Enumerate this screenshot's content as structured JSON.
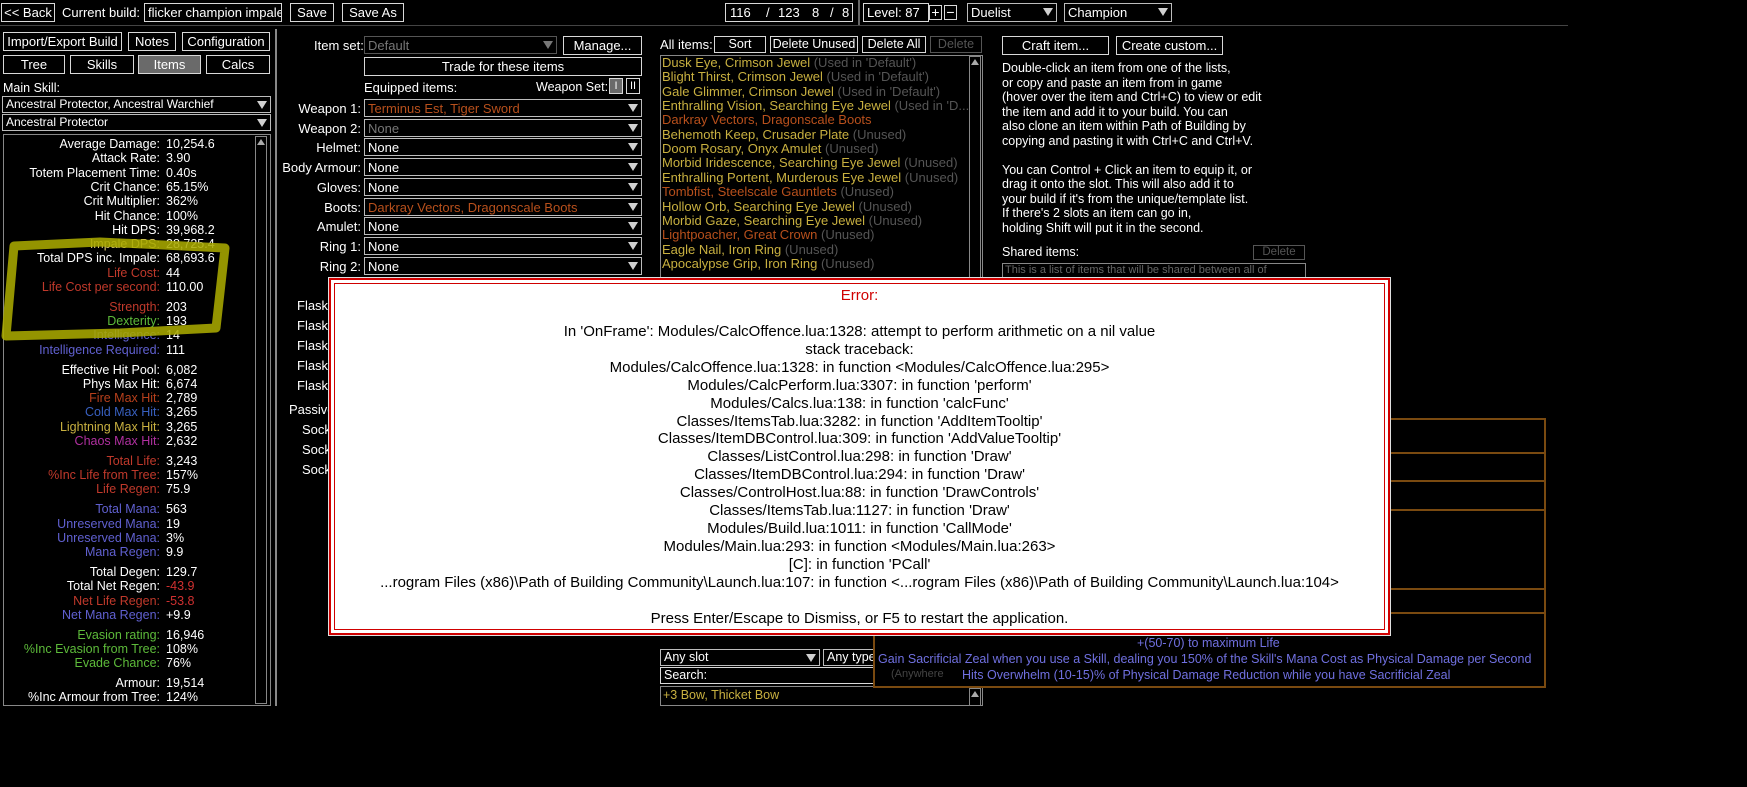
{
  "topbar": {
    "back": "<< Back",
    "current_build_label": "Current build:",
    "build_name": "flicker champion impale",
    "save": "Save",
    "save_as": "Save As",
    "points_used": "116",
    "points_total": "123",
    "asc_used": "8",
    "asc_total": "8",
    "level": "Level: 87",
    "class": "Duelist",
    "ascendancy": "Champion",
    "plus": "+",
    "minus": "−",
    "slash1": "/",
    "slash2": "/"
  },
  "left": {
    "import_export": "Import/Export Build",
    "notes": "Notes",
    "configuration": "Configuration",
    "tabs": [
      "Tree",
      "Skills",
      "Items",
      "Calcs"
    ],
    "main_skill_label": "Main Skill:",
    "main_skill": "Ancestral Protector, Ancestral Warchief",
    "sub_skill": "Ancestral Protector"
  },
  "stats": [
    {
      "label": "Average Damage:",
      "value": "10,254.6",
      "color": "#ffffff"
    },
    {
      "label": "Attack Rate:",
      "value": "3.90",
      "color": "#ffffff"
    },
    {
      "label": "Totem Placement Time:",
      "value": "0.40s",
      "color": "#ffffff"
    },
    {
      "label": "Crit Chance:",
      "value": "65.15%",
      "color": "#ffffff"
    },
    {
      "label": "Crit Multiplier:",
      "value": "362%",
      "color": "#ffffff"
    },
    {
      "label": "Hit Chance:",
      "value": "100%",
      "color": "#ffffff"
    },
    {
      "label": "Hit DPS:",
      "value": "39,968.2",
      "color": "#ffffff"
    },
    {
      "label": "Impale DPS:",
      "value": "28,725.4",
      "color": "#e0d070"
    },
    {
      "label": "Total DPS inc. Impale:",
      "value": "68,693.6",
      "color": "#ffffff"
    },
    {
      "label": "Life Cost:",
      "value": "44",
      "color": "#c0392b"
    },
    {
      "label": "Life Cost per second:",
      "value": "110.00",
      "color": "#c0392b"
    },
    {
      "gap": true
    },
    {
      "label": "Strength:",
      "value": "203",
      "color": "#c0392b"
    },
    {
      "label": "Dexterity:",
      "value": "193",
      "color": "#5dbb3a"
    },
    {
      "label": "Intelligence:",
      "value": "14",
      "color": "#6060d0"
    },
    {
      "label": "Intelligence Required:",
      "value": "111",
      "color": "#6060d0"
    },
    {
      "gap": true
    },
    {
      "label": "Effective Hit Pool:",
      "value": "6,082",
      "color": "#ffffff"
    },
    {
      "label": "Phys Max Hit:",
      "value": "6,674",
      "color": "#ffffff"
    },
    {
      "label": "Fire Max Hit:",
      "value": "2,789",
      "color": "#b8401c"
    },
    {
      "label": "Cold Max Hit:",
      "value": "3,265",
      "color": "#3860c0"
    },
    {
      "label": "Lightning Max Hit:",
      "value": "3,265",
      "color": "#c8b040"
    },
    {
      "label": "Chaos Max Hit:",
      "value": "2,632",
      "color": "#b030a0"
    },
    {
      "gap": true
    },
    {
      "label": "Total Life:",
      "value": "3,243",
      "color": "#c0392b"
    },
    {
      "label": "%Inc Life from Tree:",
      "value": "157%",
      "color": "#c0392b"
    },
    {
      "label": "Life Regen:",
      "value": "75.9",
      "color": "#c0392b"
    },
    {
      "gap": true
    },
    {
      "label": "Total Mana:",
      "value": "563",
      "color": "#6060d0"
    },
    {
      "label": "Unreserved Mana:",
      "value": "19",
      "color": "#6060d0"
    },
    {
      "label": "Unreserved Mana:",
      "value": "3%",
      "color": "#6060d0"
    },
    {
      "label": "Mana Regen:",
      "value": "9.9",
      "color": "#6060d0"
    },
    {
      "gap": true
    },
    {
      "label": "Total Degen:",
      "value": "129.7",
      "color": "#ffffff"
    },
    {
      "label": "Total Net Regen:",
      "value": "-43.9",
      "color": "#ffffff",
      "vcolor": "#d03030"
    },
    {
      "label": "Net Life Regen:",
      "value": "-53.8",
      "color": "#c0392b",
      "vcolor": "#d03030"
    },
    {
      "label": "Net Mana Regen:",
      "value": "+9.9",
      "color": "#6060d0"
    },
    {
      "gap": true
    },
    {
      "label": "Evasion rating:",
      "value": "16,946",
      "color": "#5dbb3a"
    },
    {
      "label": "%Inc Evasion from Tree:",
      "value": "108%",
      "color": "#5dbb3a"
    },
    {
      "label": "Evade Chance:",
      "value": "76%",
      "color": "#5dbb3a"
    },
    {
      "gap": true
    },
    {
      "label": "Armour:",
      "value": "19,514",
      "color": "#ffffff"
    },
    {
      "label": "%Inc Armour from Tree:",
      "value": "124%",
      "color": "#ffffff"
    }
  ],
  "middle": {
    "item_set_label": "Item set:",
    "item_set": "Default",
    "manage": "Manage...",
    "trade": "Trade for these items",
    "equipped_label": "Equipped items:",
    "weapon_set_label": "Weapon Set:",
    "weapon_set_1": "I",
    "weapon_set_2": "II",
    "slots": [
      {
        "label": "Weapon 1:",
        "value": "Terminus Est, Tiger Sword",
        "color": "#b8501c"
      },
      {
        "label": "Weapon 2:",
        "value": "None",
        "color": "#777777"
      },
      {
        "label": "Helmet:",
        "value": "None",
        "color": "#ffffff"
      },
      {
        "label": "Body Armour:",
        "value": "None",
        "color": "#ffffff"
      },
      {
        "label": "Gloves:",
        "value": "None",
        "color": "#ffffff"
      },
      {
        "label": "Boots:",
        "value": "Darkray Vectors, Dragonscale Boots",
        "color": "#b8501c"
      },
      {
        "label": "Amulet:",
        "value": "None",
        "color": "#ffffff"
      },
      {
        "label": "Ring 1:",
        "value": "None",
        "color": "#ffffff"
      },
      {
        "label": "Ring 2:",
        "value": "None",
        "color": "#ffffff"
      }
    ],
    "flask_label": "Flask",
    "passive_label": "Passive",
    "sock_label": "Sock"
  },
  "items": {
    "label": "All items:",
    "sort": "Sort",
    "delete_unused": "Delete Unused",
    "delete_all": "Delete All",
    "delete": "Delete",
    "list": [
      {
        "name": "Dusk Eye, Crimson Jewel",
        "note": " (Used in 'Default')",
        "color": "#c8b040"
      },
      {
        "name": "Blight Thirst, Crimson Jewel",
        "note": " (Used in 'Default')",
        "color": "#c8b040"
      },
      {
        "name": "Gale Glimmer, Crimson Jewel",
        "note": " (Used in 'Default')",
        "color": "#c8b040"
      },
      {
        "name": "Enthralling Vision, Searching Eye Jewel",
        "note": " (Used in 'D...",
        "color": "#c8b040"
      },
      {
        "name": "Darkray Vectors, Dragonscale Boots",
        "note": "",
        "color": "#b8501c"
      },
      {
        "name": "Behemoth Keep, Crusader Plate",
        "note": " (Unused)",
        "color": "#c8b040"
      },
      {
        "name": "Doom Rosary, Onyx Amulet",
        "note": " (Unused)",
        "color": "#c8b040"
      },
      {
        "name": "Morbid Iridescence, Searching Eye Jewel",
        "note": " (Unused)",
        "color": "#c8b040"
      },
      {
        "name": "Enthralling Portent, Murderous Eye Jewel",
        "note": " (Unused)",
        "color": "#c8b040"
      },
      {
        "name": "Tombfist, Steelscale Gauntlets",
        "note": " (Unused)",
        "color": "#b8501c"
      },
      {
        "name": "Hollow Orb, Searching Eye Jewel",
        "note": " (Unused)",
        "color": "#c8b040"
      },
      {
        "name": "Morbid Gaze, Searching Eye Jewel",
        "note": " (Unused)",
        "color": "#c8b040"
      },
      {
        "name": "Lightpoacher, Great Crown",
        "note": " (Unused)",
        "color": "#b8501c"
      },
      {
        "name": "Eagle Nail, Iron Ring",
        "note": " (Unused)",
        "color": "#c8b040"
      },
      {
        "name": "Apocalypse Grip, Iron Ring",
        "note": " (Unused)",
        "color": "#c8b040"
      }
    ],
    "any_slot": "Any slot",
    "any_type": "Any type",
    "search_label": "Search:",
    "db_first": "+3 Bow, Thicket Bow"
  },
  "right": {
    "craft": "Craft item...",
    "create_custom": "Create custom...",
    "help_lines": [
      "Double-click an item from one of the lists,",
      "or copy and paste an item from in game",
      "(hover over the item and Ctrl+C) to view or edit",
      "the item and add it to your build. You can",
      "also clone an item within Path of Building by",
      "copying and pasting it with Ctrl+C and Ctrl+V.",
      "",
      "You can Control + Click an item to equip it, or",
      "drag it onto the slot.  This will also add it to",
      "your build if it's from the unique/template list.",
      "If there's 2 slots an item can go in,",
      "holding Shift will put it in the second."
    ],
    "shared_label": "Shared items:",
    "shared_delete": "Delete",
    "shared_placeholder": "This is a list of items that will be shared between all of",
    "tooltip_life": "+(50-70) to maximum Life",
    "tooltip_zeal": "Gain Sacrificial Zeal when you use a Skill, dealing you 150% of the Skill's Mana Cost as Physical Damage per Second",
    "tooltip_anywhere": "(Anywhere",
    "tooltip_overwhelm": "Hits Overwhelm (10-15)% of Physical Damage Reduction while you have Sacrificial Zeal"
  },
  "error": {
    "title": "Error:",
    "lines": [
      "In 'OnFrame': Modules/CalcOffence.lua:1328: attempt to perform arithmetic on a nil value",
      "stack traceback:",
      "Modules/CalcOffence.lua:1328: in function <Modules/CalcOffence.lua:295>",
      "Modules/CalcPerform.lua:3307: in function 'perform'",
      "Modules/Calcs.lua:138: in function 'calcFunc'",
      "Classes/ItemsTab.lua:3282: in function 'AddItemTooltip'",
      "Classes/ItemDBControl.lua:309: in function 'AddValueTooltip'",
      "Classes/ListControl.lua:298: in function 'Draw'",
      "Classes/ItemDBControl.lua:294: in function 'Draw'",
      "Classes/ControlHost.lua:88: in function 'DrawControls'",
      "Classes/ItemsTab.lua:1127: in function 'Draw'",
      "Modules/Build.lua:1011: in function 'CallMode'",
      "Modules/Main.lua:293: in function <Modules/Main.lua:263>",
      "[C]: in function 'PCall'",
      "...rogram Files (x86)\\Path of Building Community\\Launch.lua:107: in function <...rogram Files (x86)\\Path of Building Community\\Launch.lua:104>"
    ],
    "dismiss": "Press Enter/Escape to Dismiss, or F5 to restart the application."
  },
  "colors": {
    "highlight": "#a8a800",
    "error_red": "#d00000",
    "unique": "#b8501c",
    "rare": "#c8b040"
  }
}
